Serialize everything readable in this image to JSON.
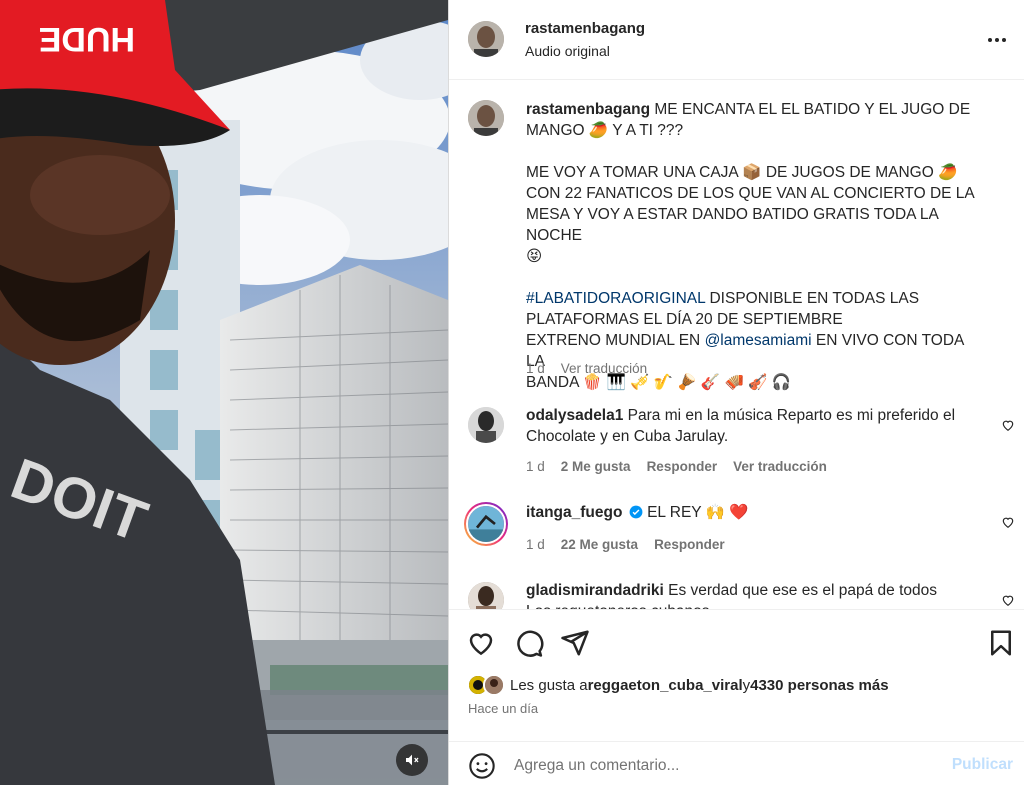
{
  "post": {
    "username": "rastamenbagang",
    "audio": "Audio original"
  },
  "caption": {
    "username": "rastamenbagang",
    "line1": " ME ENCANTA EL EL BATIDO Y EL JUGO DE",
    "line2": "MANGO 🥭  Y A TI ???",
    "line3": "ME VOY A TOMAR UNA CAJA 📦 DE JUGOS DE MANGO 🥭",
    "line4": "CON 22 FANATICOS DE LOS QUE VAN AL CONCIERTO DE LA",
    "line5": "MESA Y VOY A ESTAR DANDO BATIDO GRATIS TODA LA NOCHE",
    "line6": "😝",
    "hashtag": "#LABATIDORAORIGINAL",
    "line7": " DISPONIBLE EN TODAS LAS",
    "line8": "PLATAFORMAS EL DÍA 20 DE SEPTIEMBRE",
    "line9a": "EXTRENO MUNDIAL EN ",
    "mention": "@lamesamiami",
    "line9b": " EN VIVO CON TODA LA",
    "line10": "BANDA 🍿 🎹 🎺 🎷 🪘 🎸 🪗 🎻 🎧",
    "time": "1 d",
    "translate": "Ver traducción"
  },
  "comments": [
    {
      "username": "odalysadela1",
      "text1": " Para mi en la música Reparto es mi preferido el",
      "text2": "Chocolate y en Cuba Jarulay.",
      "time": "1 d",
      "likes": "2 Me gusta",
      "reply": "Responder",
      "translate": "Ver traducción"
    },
    {
      "username": "itanga_fuego",
      "text1": " EL REY 🙌 ❤️",
      "time": "1 d",
      "likes": "22 Me gusta",
      "reply": "Responder"
    },
    {
      "username": "gladismirandadriki",
      "text1": " Es verdad que ese es el papá de todos",
      "text2": "Los reguetoneros cubanos"
    }
  ],
  "likes": {
    "prefix": "Les gusta a ",
    "user": "reggaeton_cuba_viral",
    "middle": " y ",
    "count": "4330 personas más"
  },
  "posted": "Hace un día",
  "add_comment": {
    "placeholder": "Agrega un comentario...",
    "publish": "Publicar"
  },
  "icons": {
    "more": "more-horizontal-icon",
    "like": "heart-icon",
    "comment": "comment-icon",
    "share": "send-icon",
    "save": "bookmark-icon",
    "emoji": "emoji-icon",
    "mute": "speaker-muted-icon",
    "verified": "verified-badge-icon"
  },
  "colors": {
    "link": "#00376b",
    "secondary": "#737373",
    "publish_disabled": "#c0dffd",
    "verified": "#0095f6",
    "heart_red": "#ed4956"
  }
}
